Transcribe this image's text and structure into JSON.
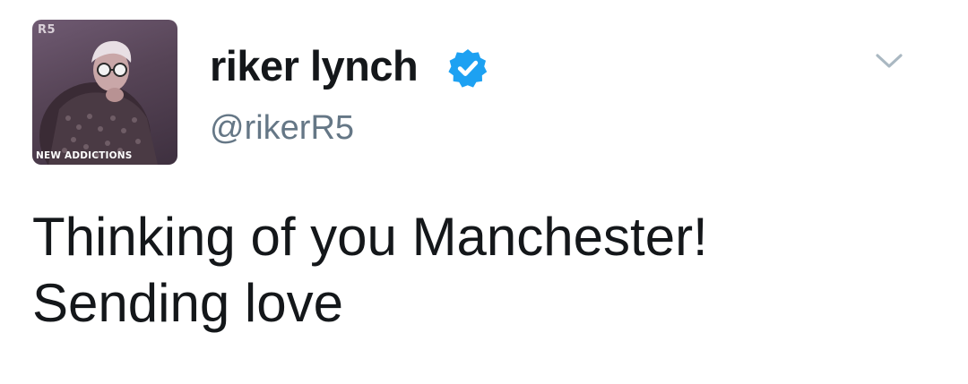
{
  "tweet": {
    "avatar": {
      "tag": "R5",
      "album": "NEW ADDICTIONS"
    },
    "author": {
      "display_name": "riker lynch",
      "handle": "@rikerR5",
      "verified": true
    },
    "text_lines": [
      "Thinking of you Manchester!",
      "Sending love"
    ],
    "icons": {
      "verified": "verified-badge-icon",
      "menu": "chevron-down-icon"
    },
    "colors": {
      "verified_blue": "#1da1f2",
      "text": "#14171a",
      "secondary_text": "#657786",
      "chevron": "#aab8c2"
    }
  }
}
